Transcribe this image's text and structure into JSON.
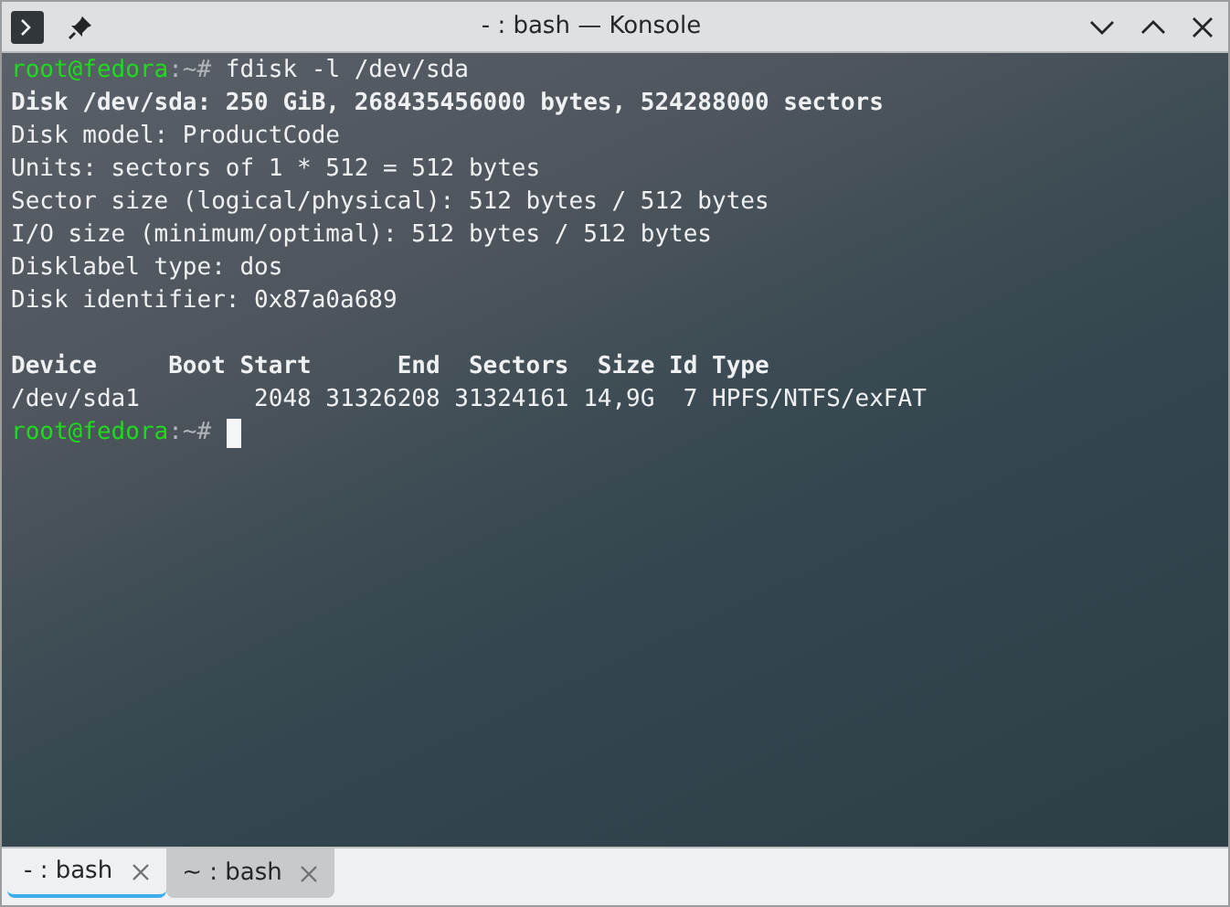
{
  "window": {
    "title": "- : bash — Konsole"
  },
  "terminal": {
    "lines": [
      {
        "kind": "prompt",
        "user": "root@fedora",
        "path": ":~#",
        "command": "fdisk -l /dev/sda",
        "cursor": false
      },
      {
        "kind": "bold",
        "text": "Disk /dev/sda: 250 GiB, 268435456000 bytes, 524288000 sectors"
      },
      {
        "kind": "plain",
        "text": "Disk model: ProductCode"
      },
      {
        "kind": "plain",
        "text": "Units: sectors of 1 * 512 = 512 bytes"
      },
      {
        "kind": "plain",
        "text": "Sector size (logical/physical): 512 bytes / 512 bytes"
      },
      {
        "kind": "plain",
        "text": "I/O size (minimum/optimal): 512 bytes / 512 bytes"
      },
      {
        "kind": "plain",
        "text": "Disklabel type: dos"
      },
      {
        "kind": "plain",
        "text": "Disk identifier: 0x87a0a689"
      },
      {
        "kind": "header",
        "text": "Device     Boot Start      End  Sectors  Size Id Type"
      },
      {
        "kind": "plain",
        "text": "/dev/sda1        2048 31326208 31324161 14,9G  7 HPFS/NTFS/exFAT"
      },
      {
        "kind": "prompt",
        "user": "root@fedora",
        "path": ":~#",
        "cursor": true
      }
    ]
  },
  "tabs": [
    {
      "label": "- : bash",
      "selected": true
    },
    {
      "label": "~ : bash",
      "selected": false
    }
  ]
}
